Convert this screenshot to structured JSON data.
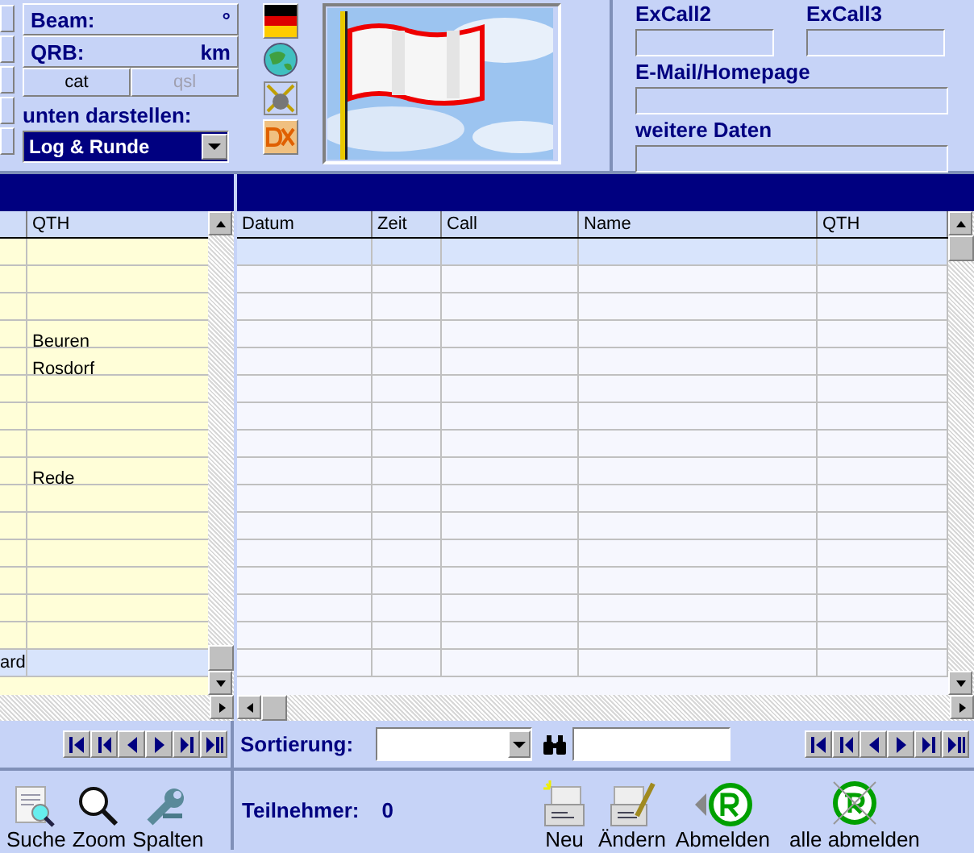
{
  "station": {
    "beam": {
      "label": "Beam:",
      "value": "°"
    },
    "qrb": {
      "label": "QRB:",
      "value": "km"
    },
    "buttons": [
      {
        "label": "cat",
        "disabled": false
      },
      {
        "label": "qsl",
        "disabled": true
      }
    ],
    "display_label": "unten darstellen:",
    "display_select": {
      "value": "Log & Runde"
    }
  },
  "details": {
    "fields": [
      {
        "label": "ExCall2"
      },
      {
        "label": "ExCall3"
      },
      {
        "label": "E-Mail/Homepage"
      },
      {
        "label": "weitere Daten"
      }
    ]
  },
  "left_grid": {
    "columns": [
      "QTH"
    ],
    "rows": [
      {
        "selected": false
      },
      {
        "selected": false
      },
      {
        "selected": false
      },
      {
        "selected": false,
        "qth": "Beuren"
      },
      {
        "selected": false,
        "qth": "Rosdorf"
      },
      {
        "selected": false
      },
      {
        "selected": false
      },
      {
        "selected": false
      },
      {
        "selected": false,
        "qth": "Rede"
      },
      {
        "selected": false
      },
      {
        "selected": false
      },
      {
        "selected": false
      },
      {
        "selected": false
      },
      {
        "selected": false
      },
      {
        "selected": false
      },
      {
        "selected": true,
        "column_1": "ard"
      }
    ]
  },
  "log_grid": {
    "columns": [
      "Datum",
      "Zeit",
      "Call",
      "Name",
      "QTH"
    ],
    "rows": [
      {
        "selected": true
      },
      {
        "selected": false
      },
      {
        "selected": false
      },
      {
        "selected": false
      },
      {
        "selected": false
      },
      {
        "selected": false
      },
      {
        "selected": false
      },
      {
        "selected": false
      },
      {
        "selected": false
      },
      {
        "selected": false
      },
      {
        "selected": false
      },
      {
        "selected": false
      },
      {
        "selected": false
      },
      {
        "selected": false
      },
      {
        "selected": false
      },
      {
        "selected": false
      }
    ]
  },
  "sort": {
    "label": "Sortierung:"
  },
  "left_toolbar": [
    {
      "label": "Suche",
      "kind": "search"
    },
    {
      "label": "Zoom",
      "kind": "zoom"
    },
    {
      "label": "Spalten",
      "kind": "wrench"
    }
  ],
  "participants": {
    "label": "Teilnehmer:",
    "value": "0"
  },
  "right_toolbar": [
    {
      "label": "Neu",
      "kind": "new"
    },
    {
      "label": "Ändern",
      "kind": "edit"
    },
    {
      "label": "Abmelden",
      "kind": "logout"
    },
    {
      "label": "alle abmelden",
      "kind": "logout_all"
    }
  ]
}
